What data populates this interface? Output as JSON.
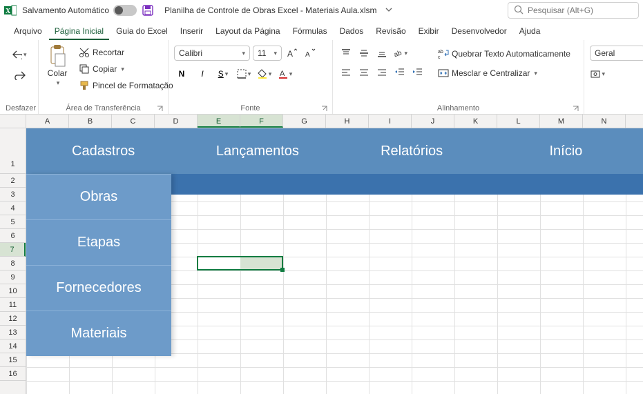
{
  "titlebar": {
    "autosave_label": "Salvamento Automático",
    "doc_title": "Planilha de Controle de Obras Excel - Materiais Aula.xlsm",
    "search_placeholder": "Pesquisar (Alt+G)"
  },
  "tabs": {
    "arquivo": "Arquivo",
    "pagina_inicial": "Página Inicial",
    "guia_excel": "Guia do Excel",
    "inserir": "Inserir",
    "layout": "Layout da Página",
    "formulas": "Fórmulas",
    "dados": "Dados",
    "revisao": "Revisão",
    "exibir": "Exibir",
    "desenvolvedor": "Desenvolvedor",
    "ajuda": "Ajuda"
  },
  "ribbon": {
    "undo_group": "Desfazer",
    "clipboard": {
      "paste": "Colar",
      "cut": "Recortar",
      "copy": "Copiar",
      "painter": "Pincel de Formatação",
      "group": "Área de Transferência"
    },
    "font": {
      "name": "Calibri",
      "size": "11",
      "bold": "N",
      "italic": "I",
      "underline": "S",
      "group": "Fonte"
    },
    "align": {
      "wrap": "Quebrar Texto Automaticamente",
      "merge": "Mesclar e Centralizar",
      "group": "Alinhamento"
    },
    "number": {
      "format": "Geral"
    }
  },
  "columns": [
    "A",
    "B",
    "C",
    "D",
    "E",
    "F",
    "G",
    "H",
    "I",
    "J",
    "K",
    "L",
    "M",
    "N"
  ],
  "rows": [
    "1",
    "2",
    "3",
    "4",
    "5",
    "6",
    "7",
    "8",
    "9",
    "10",
    "11",
    "12",
    "13",
    "14",
    "15",
    "16"
  ],
  "banner": {
    "cadastros": "Cadastros",
    "lancamentos": "Lançamentos",
    "relatorios": "Relatórios",
    "inicio": "Início"
  },
  "menu": {
    "obras": "Obras",
    "etapas": "Etapas",
    "fornecedores": "Fornecedores",
    "materiais": "Materiais"
  }
}
